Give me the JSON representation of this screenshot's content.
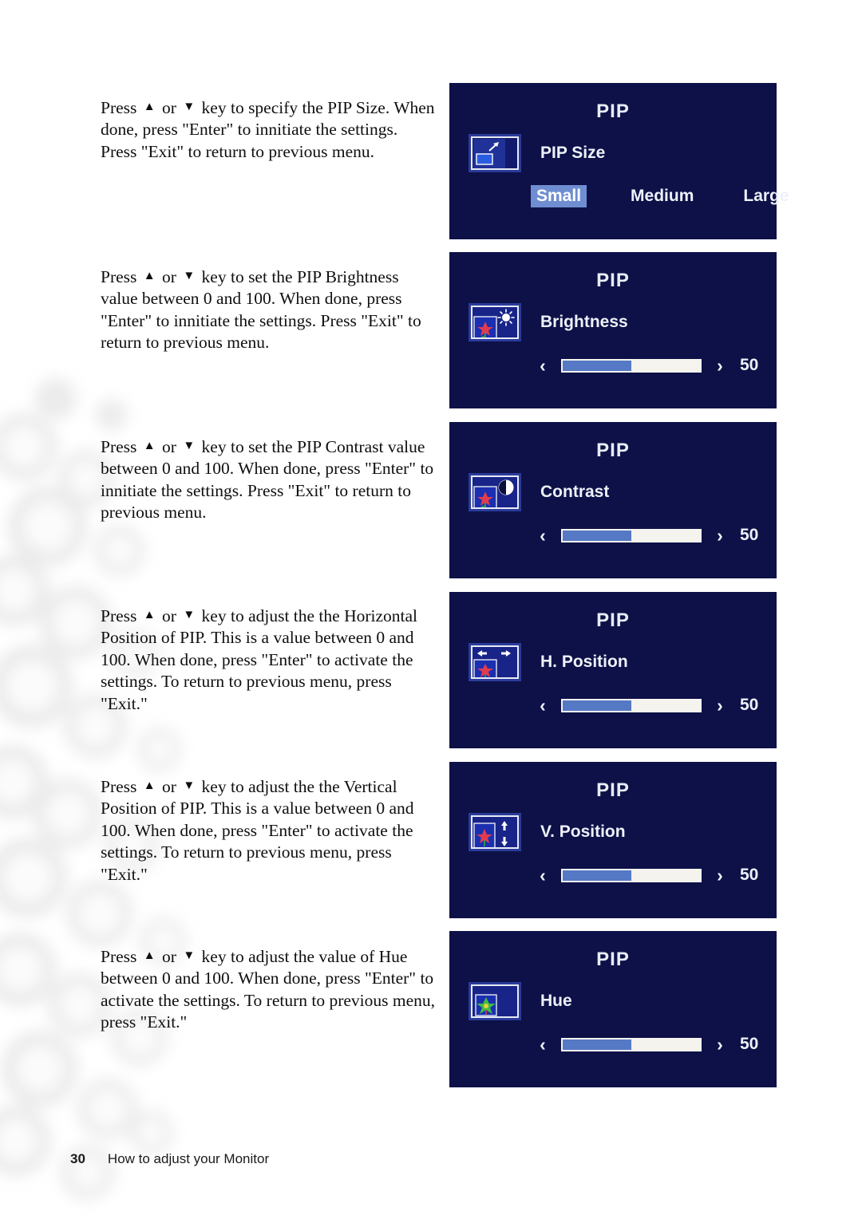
{
  "document": {
    "page_number": "30",
    "footer_text": "How to adjust your Monitor"
  },
  "instructions": [
    {
      "before": "Press",
      "up_key": "▲",
      "middle": "or",
      "down_key": "▼",
      "text": "key to specify the PIP Size. When done, press \"Enter\" to innitiate the settings. Press \"Exit\" to return to previous menu."
    },
    {
      "before": "Press",
      "up_key": "▲",
      "middle": "or",
      "down_key": "▼",
      "text": "key to set the PIP Brightness value between 0 and 100. When done, press \"Enter\" to innitiate the settings. Press \"Exit\" to return to previous menu."
    },
    {
      "before": "Press",
      "up_key": "▲",
      "middle": "or",
      "down_key": "▼",
      "text": "key to set the PIP Contrast value between 0 and 100. When done, press \"Enter\" to innitiate the settings. Press \"Exit\" to return to previous menu."
    },
    {
      "before": "Press",
      "up_key": "▲",
      "middle": "or",
      "down_key": "▼",
      "text": "key to adjust the the Horizontal Position of PIP. This is a value between 0 and 100. When done, press \"Enter\" to activate the settings. To return to previous menu, press \"Exit.\""
    },
    {
      "before": "Press",
      "up_key": "▲",
      "middle": "or",
      "down_key": "▼",
      "text": "key to adjust the the Vertical Position of PIP. This is a value between 0 and 100. When done, press \"Enter\" to activate the settings. To return to previous menu, press \"Exit.\""
    },
    {
      "before": "Press",
      "up_key": "▲",
      "middle": "or",
      "down_key": "▼",
      "text": "key to adjust the value of Hue between 0 and 100. When done, press \"Enter\" to activate the settings. To return to previous menu, press \"Exit.\""
    }
  ],
  "osd_panels": [
    {
      "title": "PIP",
      "label": "PIP Size",
      "icon": "pip-size-icon",
      "control": "options",
      "options": [
        {
          "label": "Small",
          "selected": true
        },
        {
          "label": "Medium",
          "selected": false
        },
        {
          "label": "Large",
          "selected": false
        }
      ]
    },
    {
      "title": "PIP",
      "label": "Brightness",
      "icon": "brightness-sun-icon",
      "control": "slider",
      "value": "50",
      "percent": 50,
      "arrow_left": "‹",
      "arrow_right": "›"
    },
    {
      "title": "PIP",
      "label": "Contrast",
      "icon": "contrast-half-circle-icon",
      "control": "slider",
      "value": "50",
      "percent": 50,
      "arrow_left": "‹",
      "arrow_right": "›"
    },
    {
      "title": "PIP",
      "label": "H. Position",
      "icon": "horizontal-position-arrows-icon",
      "control": "slider",
      "value": "50",
      "percent": 50,
      "arrow_left": "‹",
      "arrow_right": "›"
    },
    {
      "title": "PIP",
      "label": "V. Position",
      "icon": "vertical-position-arrows-icon",
      "control": "slider",
      "value": "50",
      "percent": 50,
      "arrow_left": "‹",
      "arrow_right": "›"
    },
    {
      "title": "PIP",
      "label": "Hue",
      "icon": "hue-flower-icon",
      "control": "slider",
      "value": "50",
      "percent": 50,
      "arrow_left": "‹",
      "arrow_right": "›"
    }
  ],
  "colors": {
    "osd_background": "#0d1147",
    "osd_text": "#eef1f9",
    "highlight": "#6f8ed2",
    "slider_fill": "#5579c4",
    "slider_track": "#f5f3ee",
    "page_background": "#ffffff"
  }
}
